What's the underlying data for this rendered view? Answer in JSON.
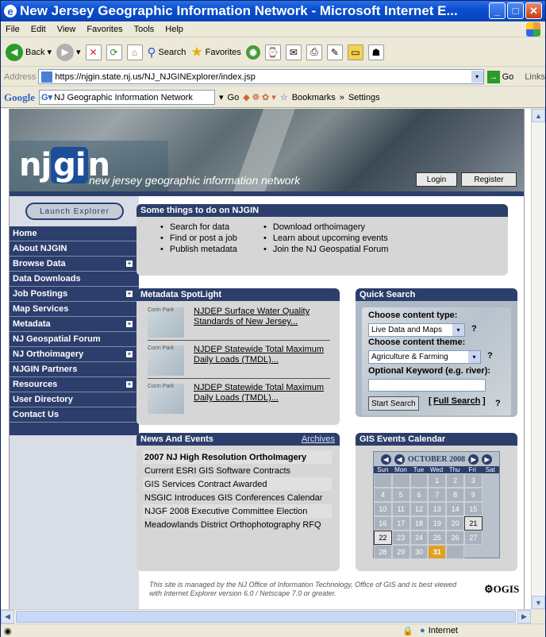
{
  "window": {
    "title": "New Jersey Geographic Information Network - Microsoft Internet E...",
    "minimize": "_",
    "maximize": "□",
    "close": "✕"
  },
  "menu": [
    "File",
    "Edit",
    "View",
    "Favorites",
    "Tools",
    "Help"
  ],
  "toolbar": {
    "back": "Back",
    "search": "Search",
    "favorites": "Favorites"
  },
  "address": {
    "label": "Address",
    "url": "https://njgin.state.nj.us/NJ_NJGINExplorer/index.jsp",
    "go": "Go",
    "links": "Links"
  },
  "googlebar": {
    "logo": "Google",
    "search_value": "NJ Geographic Information Network",
    "go": "Go",
    "bookmarks": "Bookmarks",
    "settings": "Settings"
  },
  "banner": {
    "logo_prefix": "nj",
    "logo_mid": "gi",
    "logo_suffix": "n",
    "tagline": "new jersey geographic information network",
    "login": "Login",
    "register": "Register"
  },
  "launch": "Launch Explorer",
  "nav": [
    {
      "label": "Home",
      "plus": false
    },
    {
      "label": "About NJGIN",
      "plus": false
    },
    {
      "label": "Browse Data",
      "plus": true
    },
    {
      "label": "Data Downloads",
      "plus": false
    },
    {
      "label": "Job Postings",
      "plus": true
    },
    {
      "label": "Map Services",
      "plus": false
    },
    {
      "label": "Metadata",
      "plus": true
    },
    {
      "label": "NJ Geospatial Forum",
      "plus": false
    },
    {
      "label": "NJ Orthoimagery",
      "plus": true
    },
    {
      "label": "NJGIN Partners",
      "plus": false
    },
    {
      "label": "Resources",
      "plus": true
    },
    {
      "label": "User Directory",
      "plus": false
    },
    {
      "label": "Contact Us",
      "plus": false
    }
  ],
  "todo": {
    "title": "Some things to do on NJGIN",
    "col1": [
      "Search for data",
      "Find or post a job",
      "Publish metadata"
    ],
    "col2": [
      "Download orthoimagery",
      "Learn about upcoming events",
      "Join the NJ Geospatial Forum"
    ]
  },
  "spotlight": {
    "title": "Metadata SpotLight",
    "items": [
      "NJDEP Surface Water Quality Standards of New Jersey...",
      "NJDEP Statewide Total Maximum Daily Loads (TMDL)...",
      "NJDEP Statewide Total Maximum Daily Loads (TMDL)..."
    ],
    "thumb_text": "Corin Park"
  },
  "quicksearch": {
    "title": "Quick Search",
    "type_label": "Choose content type:",
    "type_value": "Live Data and Maps",
    "theme_label": "Choose content theme:",
    "theme_value": "Agriculture & Farming",
    "keyword_label": "Optional Keyword (e.g. river):",
    "help": "?",
    "start": "Start Search",
    "full": "Full Search",
    "bracket_l": "[",
    "bracket_r": "]"
  },
  "news": {
    "title": "News And Events",
    "archives": "Archives",
    "items": [
      "2007 NJ High Resolution OrthoImagery",
      "Current ESRI GIS Software Contracts",
      "GIS Services Contract Awarded",
      "NSGIC Introduces GIS Conferences Calendar",
      "NJGF 2008 Executive Committee Election",
      "Meadowlands District Orthophotography RFQ"
    ]
  },
  "calendar": {
    "title": "GIS Events Calendar",
    "month": "OCTOBER 2008",
    "dow": [
      "Sun",
      "Mon",
      "Tue",
      "Wed",
      "Thu",
      "Fri",
      "Sat"
    ],
    "days": [
      "",
      "",
      "",
      "1",
      "2",
      "3",
      "4",
      "5",
      "6",
      "7",
      "8",
      "9",
      "10",
      "11",
      "12",
      "13",
      "14",
      "15",
      "16",
      "17",
      "18",
      "19",
      "20",
      "21",
      "22",
      "23",
      "24",
      "25",
      "26",
      "27",
      "28",
      "29",
      "30",
      "31",
      ""
    ],
    "event_days": [
      "21",
      "22"
    ],
    "today": "31"
  },
  "footer": {
    "text": "This site is managed by the NJ Office of Information Technology, Office of GIS and is best viewed with Internet Explorer version 6.0 / Netscape 7.0 or greater.",
    "logo": "OGIS"
  },
  "status": {
    "zone": "Internet"
  }
}
